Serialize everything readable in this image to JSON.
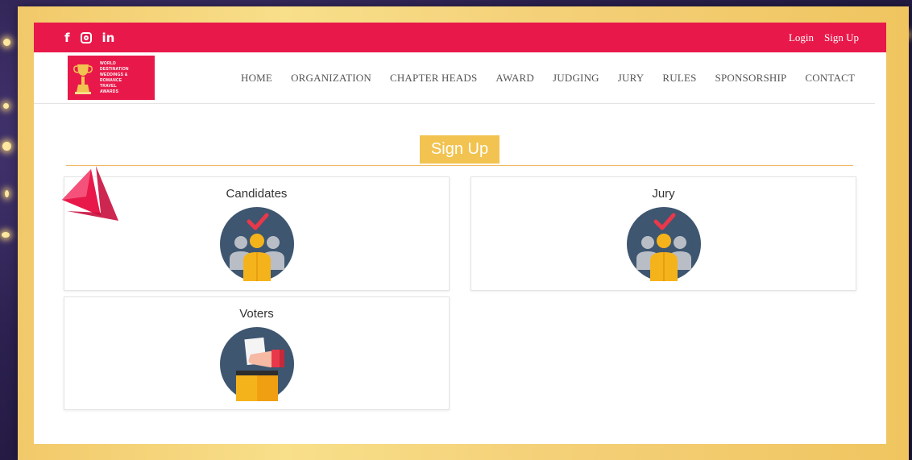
{
  "social": {
    "icons": [
      "facebook-icon",
      "instagram-icon",
      "linkedin-icon"
    ],
    "facebook": "f",
    "linkedin": "in"
  },
  "auth": {
    "login": "Login",
    "signup": "Sign Up"
  },
  "logo": {
    "lines": [
      "WORLD",
      "DESTINATION",
      "WEDDINGS &",
      "ROMANCE",
      "TRAVEL",
      "AWARDS"
    ]
  },
  "nav": [
    "HOME",
    "ORGANIZATION",
    "CHAPTER HEADS",
    "AWARD",
    "JUDGING",
    "JURY",
    "RULES",
    "SPONSORSHIP",
    "CONTACT"
  ],
  "heading": "Sign Up",
  "cards": {
    "candidates": {
      "title": "Candidates",
      "icon": "group-check-icon"
    },
    "jury": {
      "title": "Jury",
      "icon": "group-check-icon"
    },
    "voters": {
      "title": "Voters",
      "icon": "ballot-box-icon"
    }
  },
  "colors": {
    "topbar": "#e8194a",
    "heading_bg": "#f2c350",
    "frame": "#f4d078",
    "icon_circle": "#3e5670",
    "person_front": "#f5b31b",
    "person_back": "#b9bec6",
    "check": "#e8384a"
  }
}
